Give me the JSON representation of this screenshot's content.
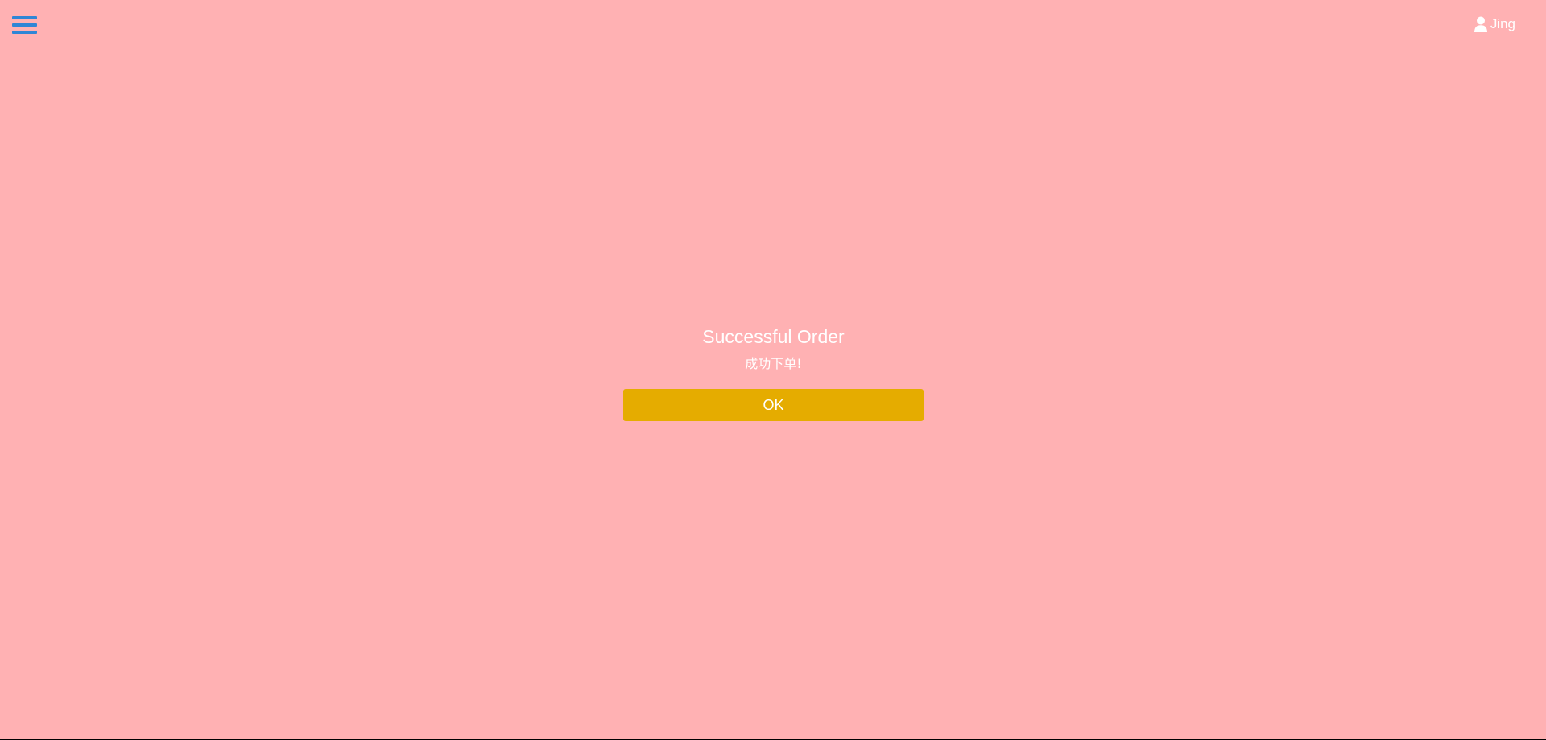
{
  "header": {
    "menu_icon": "hamburger-menu-icon",
    "user_icon": "user-icon",
    "username": "Jing"
  },
  "dialog": {
    "title": "Successful Order",
    "message": "成功下单!",
    "ok_label": "OK"
  },
  "colors": {
    "background": "#ffb1b3",
    "menu_icon": "#2f86d6",
    "ok_button": "#e5ac00",
    "text": "#ffffff"
  }
}
